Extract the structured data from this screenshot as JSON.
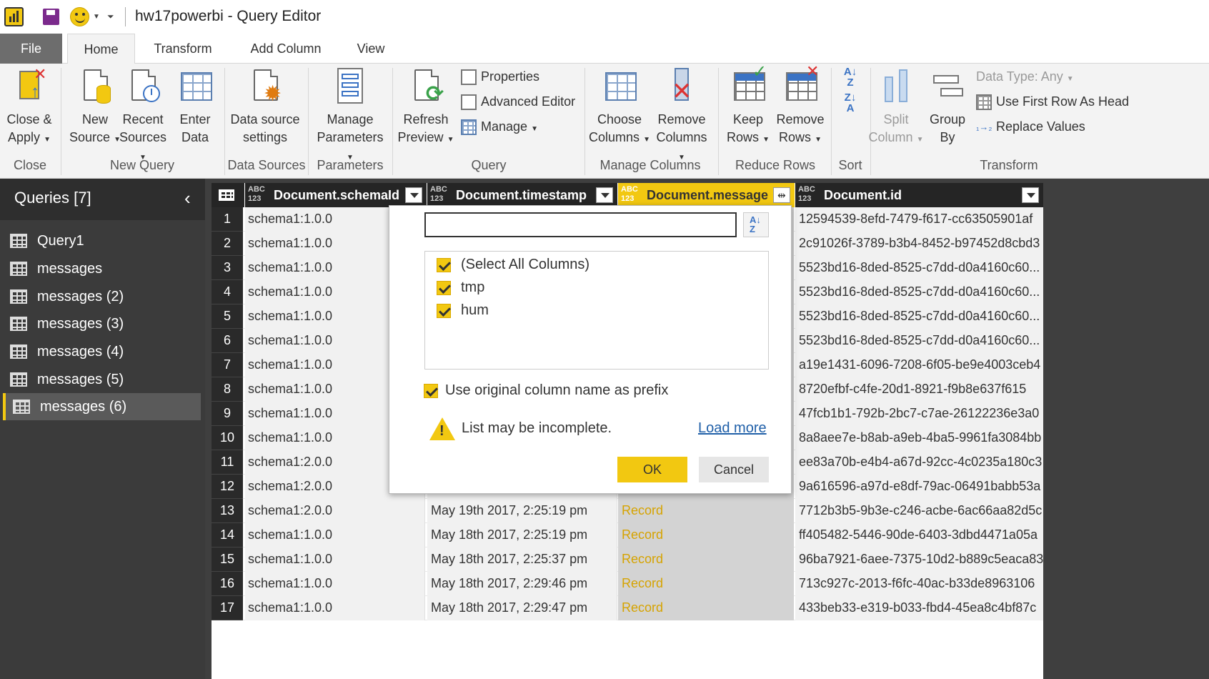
{
  "window": {
    "title": "hw17powerbi - Query Editor"
  },
  "tabs": [
    "File",
    "Home",
    "Transform",
    "Add Column",
    "View"
  ],
  "ribbon": {
    "close_apply": {
      "line1": "Close &",
      "line2": "Apply"
    },
    "new_source": {
      "line1": "New",
      "line2": "Source"
    },
    "recent_sources": {
      "line1": "Recent",
      "line2": "Sources"
    },
    "enter_data": {
      "line1": "Enter",
      "line2": "Data"
    },
    "data_source_settings": {
      "line1": "Data source",
      "line2": "settings"
    },
    "manage_parameters": {
      "line1": "Manage",
      "line2": "Parameters"
    },
    "refresh_preview": {
      "line1": "Refresh",
      "line2": "Preview"
    },
    "properties": "Properties",
    "advanced_editor": "Advanced Editor",
    "manage": "Manage",
    "choose_columns": {
      "line1": "Choose",
      "line2": "Columns"
    },
    "remove_columns": {
      "line1": "Remove",
      "line2": "Columns"
    },
    "keep_rows": {
      "line1": "Keep",
      "line2": "Rows"
    },
    "remove_rows": {
      "line1": "Remove",
      "line2": "Rows"
    },
    "split_column": {
      "line1": "Split",
      "line2": "Column"
    },
    "group_by": {
      "line1": "Group",
      "line2": "By"
    },
    "data_type": "Data Type: Any",
    "use_first_row": "Use First Row As Head",
    "replace_values": "Replace Values",
    "groups": {
      "close": "Close",
      "new_query": "New Query",
      "data_sources": "Data Sources",
      "parameters": "Parameters",
      "query": "Query",
      "manage_columns": "Manage Columns",
      "reduce_rows": "Reduce Rows",
      "sort": "Sort",
      "transform": "Transform"
    }
  },
  "queries": {
    "title": "Queries [7]",
    "items": [
      "Query1",
      "messages",
      "messages (2)",
      "messages (3)",
      "messages (4)",
      "messages (5)",
      "messages (6)"
    ],
    "active_index": 6
  },
  "grid": {
    "type_label": "ABC\n123",
    "columns": [
      "Document.schemaId",
      "Document.timestamp",
      "Document.message",
      "Document.id"
    ],
    "rows": [
      {
        "n": "1",
        "schema": "schema1:1.0.0",
        "timestamp": "",
        "message": "",
        "id": "12594539-8efd-7479-f617-cc63505901af"
      },
      {
        "n": "2",
        "schema": "schema1:1.0.0",
        "timestamp": "",
        "message": "",
        "id": "2c91026f-3789-b3b4-8452-b97452d8cbd3"
      },
      {
        "n": "3",
        "schema": "schema1:1.0.0",
        "timestamp": "",
        "message": "",
        "id": "5523bd16-8ded-8525-c7dd-d0a4160c60..."
      },
      {
        "n": "4",
        "schema": "schema1:1.0.0",
        "timestamp": "",
        "message": "",
        "id": "5523bd16-8ded-8525-c7dd-d0a4160c60..."
      },
      {
        "n": "5",
        "schema": "schema1:1.0.0",
        "timestamp": "",
        "message": "",
        "id": "5523bd16-8ded-8525-c7dd-d0a4160c60..."
      },
      {
        "n": "6",
        "schema": "schema1:1.0.0",
        "timestamp": "",
        "message": "",
        "id": "5523bd16-8ded-8525-c7dd-d0a4160c60..."
      },
      {
        "n": "7",
        "schema": "schema1:1.0.0",
        "timestamp": "",
        "message": "",
        "id": "a19e1431-6096-7208-6f05-be9e4003ceb4"
      },
      {
        "n": "8",
        "schema": "schema1:1.0.0",
        "timestamp": "",
        "message": "",
        "id": "8720efbf-c4fe-20d1-8921-f9b8e637f615"
      },
      {
        "n": "9",
        "schema": "schema1:1.0.0",
        "timestamp": "",
        "message": "",
        "id": "47fcb1b1-792b-2bc7-c7ae-26122236e3a0"
      },
      {
        "n": "10",
        "schema": "schema1:1.0.0",
        "timestamp": "",
        "message": "",
        "id": "8a8aee7e-b8ab-a9eb-4ba5-9961fa3084bb"
      },
      {
        "n": "11",
        "schema": "schema1:2.0.0",
        "timestamp": "",
        "message": "",
        "id": "ee83a70b-e4b4-a67d-92cc-4c0235a180c3"
      },
      {
        "n": "12",
        "schema": "schema1:2.0.0",
        "timestamp": "",
        "message": "",
        "id": "9a616596-a97d-e8df-79ac-06491babb53a"
      },
      {
        "n": "13",
        "schema": "schema1:2.0.0",
        "timestamp": "May 19th 2017, 2:25:19 pm",
        "message": "Record",
        "id": "7712b3b5-9b3e-c246-acbe-6ac66aa82d5c"
      },
      {
        "n": "14",
        "schema": "schema1:1.0.0",
        "timestamp": "May 18th 2017, 2:25:19 pm",
        "message": "Record",
        "id": "ff405482-5446-90de-6403-3dbd4471a05a"
      },
      {
        "n": "15",
        "schema": "schema1:1.0.0",
        "timestamp": "May 18th 2017, 2:25:37 pm",
        "message": "Record",
        "id": "96ba7921-6aee-7375-10d2-b889c5eaca83"
      },
      {
        "n": "16",
        "schema": "schema1:1.0.0",
        "timestamp": "May 18th 2017, 2:29:46 pm",
        "message": "Record",
        "id": "713c927c-2013-f6fc-40ac-b33de8963106"
      },
      {
        "n": "17",
        "schema": "schema1:1.0.0",
        "timestamp": "May 18th 2017, 2:29:47 pm",
        "message": "Record",
        "id": "433beb33-e319-b033-fbd4-45ea8c4bf87c"
      }
    ]
  },
  "expand_popup": {
    "search_value": "",
    "options": [
      "(Select All Columns)",
      "tmp",
      "hum"
    ],
    "prefix_label": "Use original column name as prefix",
    "warning": "List may be incomplete.",
    "load_more": "Load more",
    "ok": "OK",
    "cancel": "Cancel"
  },
  "colors": {
    "accent": "#f2c811",
    "link": "#1f5fa8",
    "pane_bg": "#3b3b3b",
    "file_tab": "#6d6d6d"
  }
}
